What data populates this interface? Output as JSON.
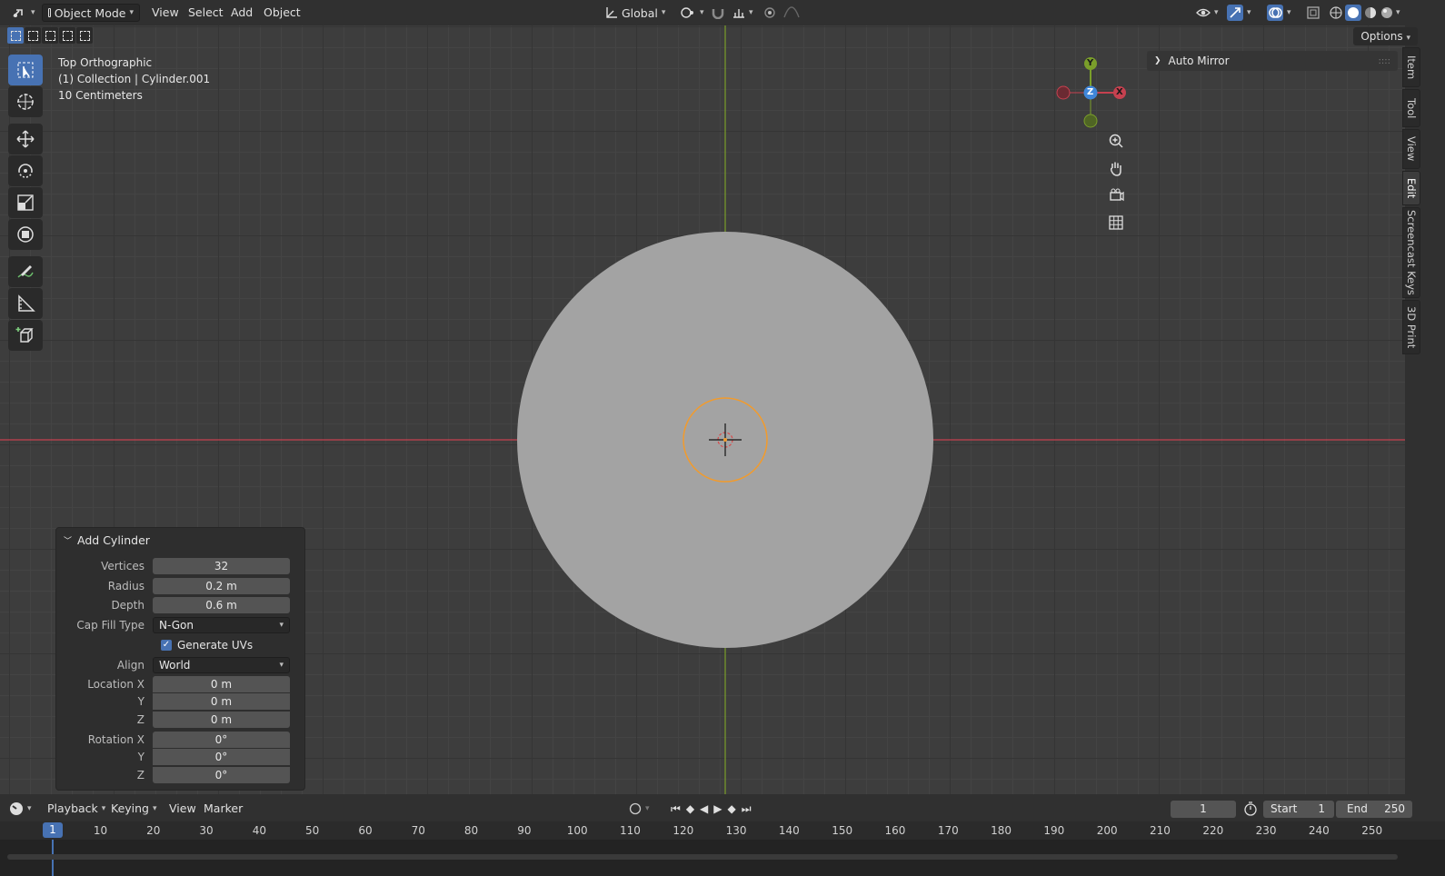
{
  "header": {
    "mode": "Object Mode",
    "menus": [
      "View",
      "Select",
      "Add",
      "Object"
    ],
    "orientation": "Global"
  },
  "viewport": {
    "view_name": "Top Orthographic",
    "collection": "(1) Collection | Cylinder.001",
    "scale": "10 Centimeters",
    "options_label": "Options",
    "auto_mirror": "Auto Mirror",
    "gizmo": {
      "y": "Y",
      "z": "Z",
      "x": "X"
    },
    "colors": {
      "x_axis": "#c6414f",
      "y_axis": "#7a9e2a",
      "z_axis": "#3f86d9",
      "selection": "#f29b2c",
      "mesh": "#a3a3a3"
    }
  },
  "sidebar_tabs": [
    "Item",
    "Tool",
    "View",
    "Edit",
    "Screencast Keys",
    "3D Print"
  ],
  "add_cylinder": {
    "title": "Add Cylinder",
    "vertices_label": "Vertices",
    "vertices": "32",
    "radius_label": "Radius",
    "radius": "0.2 m",
    "depth_label": "Depth",
    "depth": "0.6 m",
    "cap_fill_label": "Cap Fill Type",
    "cap_fill": "N-Gon",
    "generate_uvs": "Generate UVs",
    "align_label": "Align",
    "align": "World",
    "location_label": "Location X",
    "loc_x": "0 m",
    "y_label": "Y",
    "loc_y": "0 m",
    "z_label": "Z",
    "loc_z": "0 m",
    "rotation_label": "Rotation X",
    "rot_x": "0°",
    "rot_y": "0°",
    "rot_z": "0°"
  },
  "timeline": {
    "menus": [
      "Playback",
      "Keying",
      "View",
      "Marker"
    ],
    "current_frame": "1",
    "start_label": "Start",
    "start": "1",
    "end_label": "End",
    "end": "250",
    "ticks": [
      "10",
      "20",
      "30",
      "40",
      "50",
      "60",
      "70",
      "80",
      "90",
      "100",
      "110",
      "120",
      "130",
      "140",
      "150",
      "160",
      "170",
      "180",
      "190",
      "200",
      "210",
      "220",
      "230",
      "240",
      "250"
    ]
  }
}
